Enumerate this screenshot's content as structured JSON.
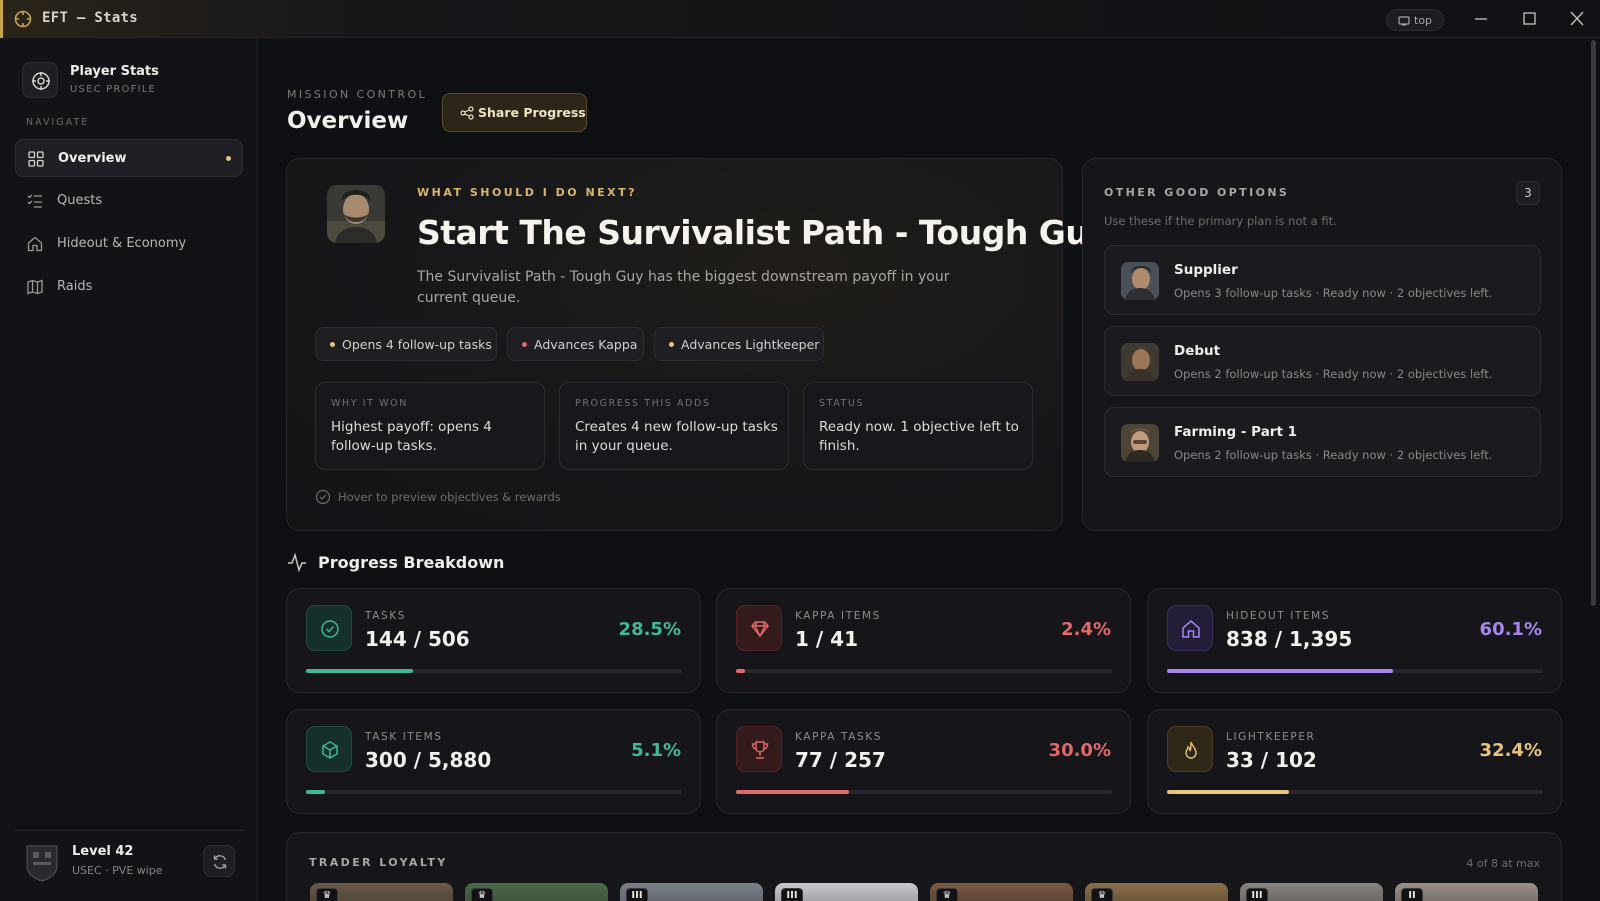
{
  "app": {
    "title": "EFT — Stats",
    "pin_label": "top"
  },
  "sidebar": {
    "profile_name": "Player Stats",
    "profile_sub": "USEC PROFILE",
    "nav_title": "NAVIGATE",
    "items": [
      {
        "label": "Overview",
        "icon": "grid-icon",
        "active": true
      },
      {
        "label": "Quests",
        "icon": "checklist-icon"
      },
      {
        "label": "Hideout & Economy",
        "icon": "home-icon"
      },
      {
        "label": "Raids",
        "icon": "map-icon"
      }
    ],
    "player_level": "Level 42",
    "player_sub": "USEC · PVE wipe"
  },
  "header": {
    "eyebrow": "MISSION CONTROL",
    "title": "Overview",
    "share_label": "Share Progress"
  },
  "hero": {
    "eyebrow": "WHAT SHOULD I DO NEXT?",
    "title": "Start The Survivalist Path - Tough Guy",
    "description": "The Survivalist Path - Tough Guy has the biggest downstream payoff in your current queue.",
    "chips": [
      {
        "label": "Opens 4 follow-up tasks",
        "color": "#e4c778"
      },
      {
        "label": "Advances Kappa",
        "color": "#e06868"
      },
      {
        "label": "Advances Lightkeeper",
        "color": "#e4c778"
      }
    ],
    "boxes": [
      {
        "heading": "WHY IT WON",
        "text": "Highest payoff: opens 4 follow-up tasks."
      },
      {
        "heading": "PROGRESS THIS ADDS",
        "text": "Creates 4 new follow-up tasks in your queue."
      },
      {
        "heading": "STATUS",
        "text": "Ready now. 1 objective left to finish."
      }
    ],
    "hint": "Hover to preview objectives & rewards"
  },
  "options": {
    "title": "OTHER GOOD OPTIONS",
    "subtitle": "Use these if the primary plan is not a fit.",
    "count": "3",
    "items": [
      {
        "name": "Supplier",
        "detail": "Opens 3 follow-up tasks · Ready now · 2 objectives left."
      },
      {
        "name": "Debut",
        "detail": "Opens 2 follow-up tasks · Ready now · 2 objectives left."
      },
      {
        "name": "Farming - Part 1",
        "detail": "Opens 2 follow-up tasks · Ready now · 2 objectives left."
      }
    ]
  },
  "progress": {
    "title": "Progress Breakdown",
    "stats": [
      {
        "label": "TASKS",
        "value": "144 / 506",
        "pct": "28.5%",
        "fraction": 0.285,
        "color": "#3fb89a",
        "icon": "check-circle-icon"
      },
      {
        "label": "KAPPA ITEMS",
        "value": "1 / 41",
        "pct": "2.4%",
        "fraction": 0.024,
        "color": "#e06868",
        "icon": "gem-icon"
      },
      {
        "label": "HIDEOUT ITEMS",
        "value": "838 / 1,395",
        "pct": "60.1%",
        "fraction": 0.601,
        "color": "#a685ec",
        "icon": "home-icon"
      },
      {
        "label": "TASK ITEMS",
        "value": "300 / 5,880",
        "pct": "5.1%",
        "fraction": 0.051,
        "color": "#3fb89a",
        "icon": "box-icon"
      },
      {
        "label": "KAPPA TASKS",
        "value": "77 / 257",
        "pct": "30.0%",
        "fraction": 0.3,
        "color": "#e06868",
        "icon": "trophy-icon"
      },
      {
        "label": "LIGHTKEEPER",
        "value": "33 / 102",
        "pct": "32.4%",
        "fraction": 0.324,
        "color": "#e8c57a",
        "icon": "flame-icon"
      }
    ]
  },
  "traders": {
    "title": "TRADER LOYALTY",
    "count_text": "4 of 8 at max",
    "badges": [
      "♛",
      "♛",
      "III",
      "III",
      "♛",
      "♛",
      "III",
      "II"
    ]
  }
}
